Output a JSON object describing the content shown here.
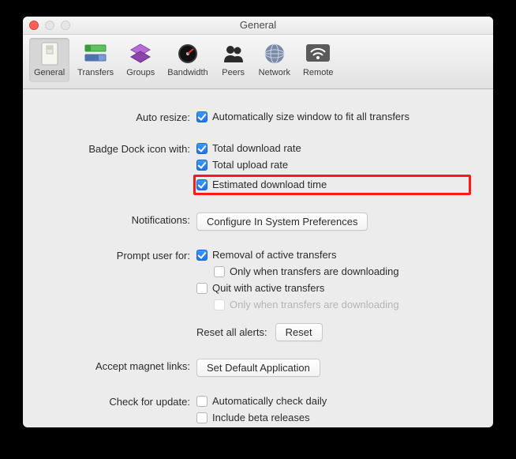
{
  "window": {
    "title": "General"
  },
  "toolbar": {
    "items": [
      {
        "id": "general",
        "label": "General"
      },
      {
        "id": "transfers",
        "label": "Transfers"
      },
      {
        "id": "groups",
        "label": "Groups"
      },
      {
        "id": "bandwidth",
        "label": "Bandwidth"
      },
      {
        "id": "peers",
        "label": "Peers"
      },
      {
        "id": "network",
        "label": "Network"
      },
      {
        "id": "remote",
        "label": "Remote"
      }
    ]
  },
  "sections": {
    "auto_resize": {
      "label": "Auto resize:",
      "opt1": "Automatically size window to fit all transfers"
    },
    "badge": {
      "label": "Badge Dock icon with:",
      "opt1": "Total download rate",
      "opt2": "Total upload rate",
      "opt3": "Estimated download time"
    },
    "notifications": {
      "label": "Notifications:",
      "button": "Configure In System Preferences"
    },
    "prompt": {
      "label": "Prompt user for:",
      "opt1": "Removal of active transfers",
      "opt1a": "Only when transfers are downloading",
      "opt2": "Quit with active transfers",
      "opt2a": "Only when transfers are downloading"
    },
    "reset": {
      "label": "Reset all alerts:",
      "button": "Reset"
    },
    "magnet": {
      "label": "Accept magnet links:",
      "button": "Set Default Application"
    },
    "update": {
      "label": "Check for update:",
      "opt1": "Automatically check daily",
      "opt2": "Include beta releases"
    }
  }
}
